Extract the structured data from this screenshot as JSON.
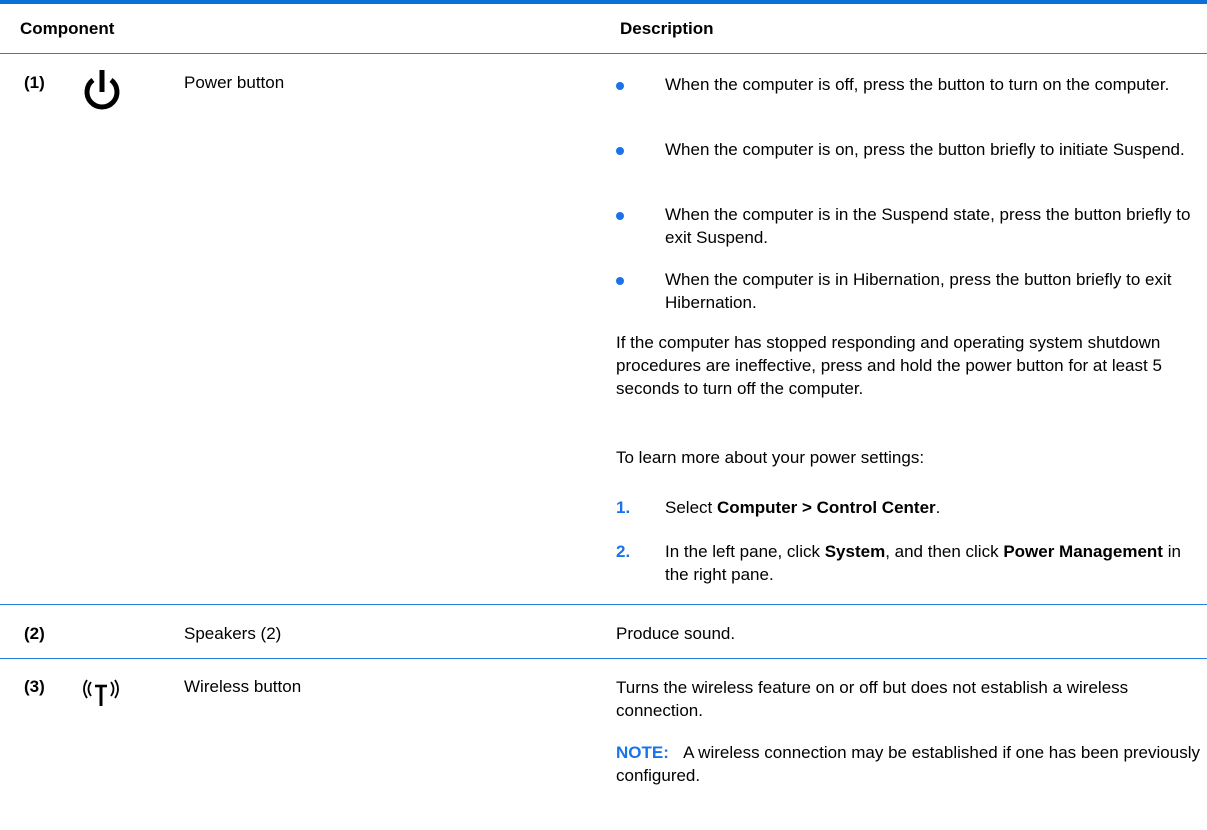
{
  "header": {
    "component": "Component",
    "description": "Description"
  },
  "rows": [
    {
      "number": "(1)",
      "name": "Power button",
      "icon": "power-icon",
      "bullets": [
        "When the computer is off, press the button to turn on the computer.",
        "When the computer is on, press the button briefly to initiate Suspend.",
        "When the computer is in the Suspend state, press the button briefly to exit Suspend.",
        "When the computer is in Hibernation, press the button briefly to exit Hibernation."
      ],
      "paragraph": "If the computer has stopped responding and operating system shutdown procedures are ineffective, press and hold the power button for at least 5 seconds to turn off the computer.",
      "intro": "To learn more about your power settings:",
      "steps": [
        {
          "num": "1.",
          "pre": "Select ",
          "bold1": "Computer > Control Center",
          "mid": ".",
          "bold2": "",
          "post": ""
        },
        {
          "num": "2.",
          "pre": "In the left pane, click ",
          "bold1": "System",
          "mid": ", and then click ",
          "bold2": "Power Management",
          "post": " in the right pane."
        }
      ]
    },
    {
      "number": "(2)",
      "name": "Speakers (2)",
      "description": "Produce sound."
    },
    {
      "number": "(3)",
      "name": "Wireless button",
      "icon": "wireless-icon",
      "description": "Turns the wireless feature on or off but does not establish a wireless connection.",
      "note_label": "NOTE:",
      "note_text": "A wireless connection may be established if one has been previously configured."
    }
  ],
  "colors": {
    "accent": "#1a73e8",
    "rule": "#2a82dc"
  }
}
